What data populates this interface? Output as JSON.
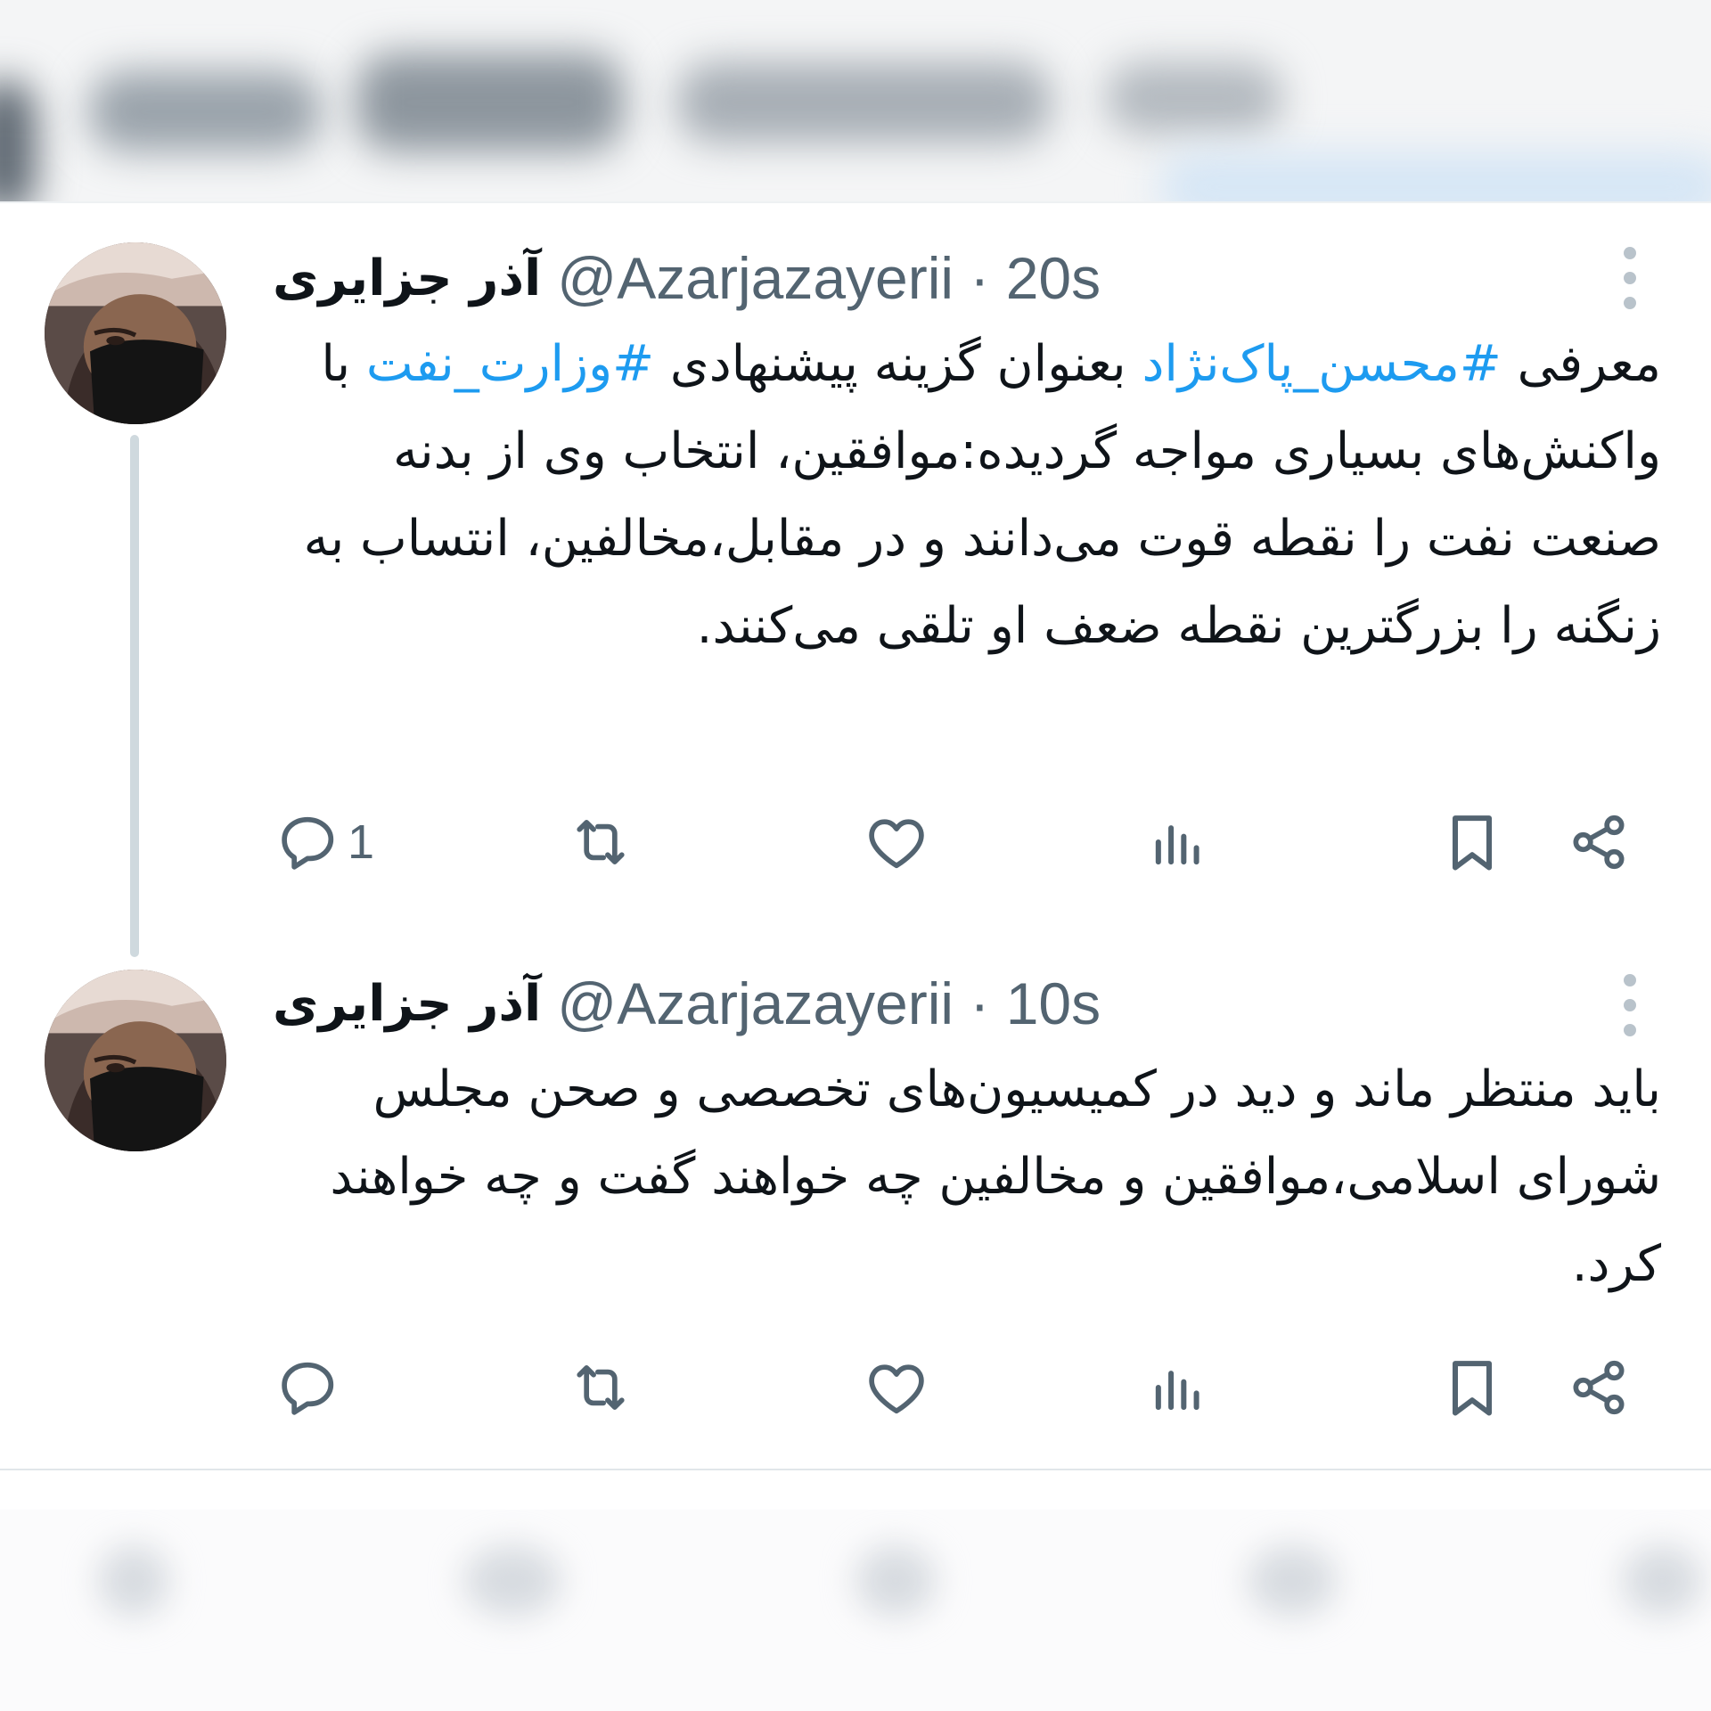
{
  "tweets": [
    {
      "display_name": "آذر جزایری",
      "handle_time": "@Azarjazayerii · 20s",
      "text_parts": [
        {
          "text": "معرفی ",
          "hashtag": false
        },
        {
          "text": "#محسن_پاک‌نژاد",
          "hashtag": true
        },
        {
          "text": " بعنوان گزینه پیشنهادی ",
          "hashtag": false
        },
        {
          "text": "#وزارت_نفت",
          "hashtag": true
        },
        {
          "text": " با واکنش‌های بسیاری مواجه گردیده:موافقین، انتخاب وی از بدنه صنعت نفت را نقطه قوت می‌دانند و در مقابل،مخالفین، انتساب به زنگنه را بزرگترین نقطه ضعف او تلقی می‌کنند.",
          "hashtag": false
        }
      ],
      "reply_count": "1"
    },
    {
      "display_name": "آذر جزایری",
      "handle_time": "@Azarjazayerii · 10s",
      "text_parts": [
        {
          "text": "باید منتظر ماند و دید در کمیسیون‌های تخصصی و صحن مجلس شورای اسلامی،موافقین و مخالفین چه خواهند گفت و چه خواهند کرد.",
          "hashtag": false
        }
      ],
      "reply_count": ""
    }
  ],
  "icons": {
    "reply": "reply-icon",
    "retweet": "retweet-icon",
    "like": "heart-icon",
    "views": "views-icon",
    "bookmark": "bookmark-icon",
    "share": "share-icon",
    "more": "more-options-icon"
  },
  "colors": {
    "hashtag": "#1d9bf0",
    "secondary_text": "#536471",
    "thread_line": "#cfd9de"
  }
}
